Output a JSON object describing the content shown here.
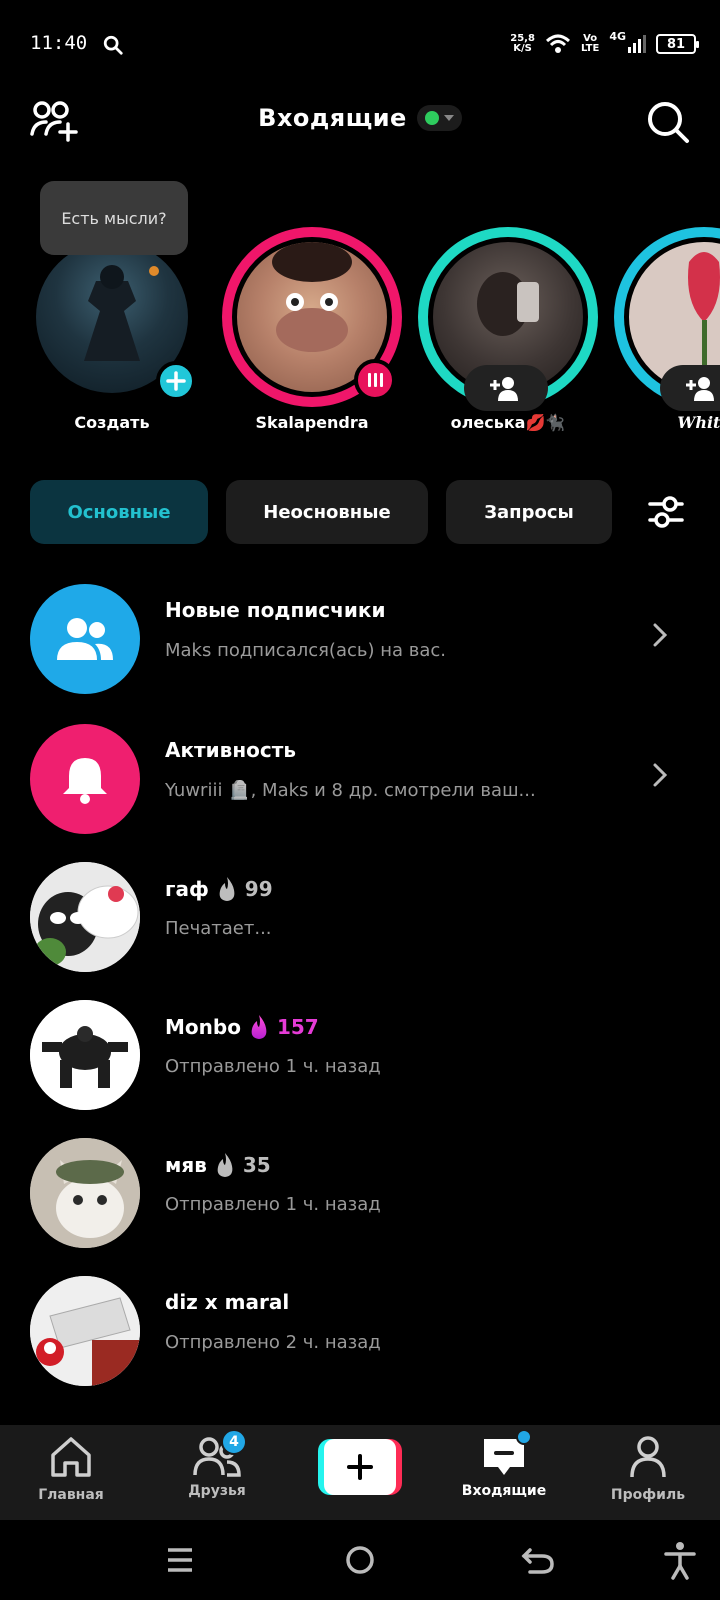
{
  "status_bar": {
    "time": "11:40",
    "speed_value": "25,8",
    "speed_unit": "K/S",
    "network_vo": "Vo",
    "network_lte": "LTE",
    "network_4g": "4G",
    "battery": "81"
  },
  "header": {
    "title": "Входящие",
    "online_status_color": "#2ecc5e"
  },
  "stories": [
    {
      "label": "Создать",
      "bubble": "Есть мысли?",
      "ring": "none"
    },
    {
      "label": "Skalapendra",
      "ring": "pink"
    },
    {
      "label": "олеська💋🐈‍⬛",
      "ring": "cyan"
    },
    {
      "label": "White",
      "ring": "cyan"
    }
  ],
  "tabs": [
    {
      "label": "Основные",
      "active": true
    },
    {
      "label": "Неосновные",
      "active": false
    },
    {
      "label": "Запросы",
      "active": false
    }
  ],
  "list": [
    {
      "title": "Новые подписчики",
      "subtitle": "Maks подписался(ась) на вас.",
      "icon": "users-icon",
      "color": "#1fa9e8"
    },
    {
      "title": "Активность",
      "subtitle": "Yuwriii 🪦, Maks и 8 др. смотрели ваш...",
      "icon": "bell-icon",
      "color": "#ef1f6f"
    },
    {
      "title": "гаф",
      "streak": "99",
      "subtitle": "Печатает...",
      "hot": false
    },
    {
      "title": "Monbo",
      "streak": "157",
      "subtitle": "Отправлено 1 ч. назад",
      "hot": true
    },
    {
      "title": "мяв",
      "streak": "35",
      "subtitle": "Отправлено 1 ч. назад",
      "hot": false
    },
    {
      "title": "diz x maral",
      "subtitle": "Отправлено 2 ч. назад"
    }
  ],
  "bottom_nav": [
    {
      "label": "Главная",
      "icon": "home-icon"
    },
    {
      "label": "Друзья",
      "icon": "friends-icon",
      "badge": "4"
    },
    {
      "label": "",
      "icon": "plus-icon"
    },
    {
      "label": "Входящие",
      "icon": "inbox-icon",
      "active": true
    },
    {
      "label": "Профиль",
      "icon": "profile-icon"
    }
  ],
  "colors": {
    "accent_cyan": "#21c7d9",
    "accent_pink": "#fe2c55",
    "hot_streak": "#e53bd6"
  }
}
